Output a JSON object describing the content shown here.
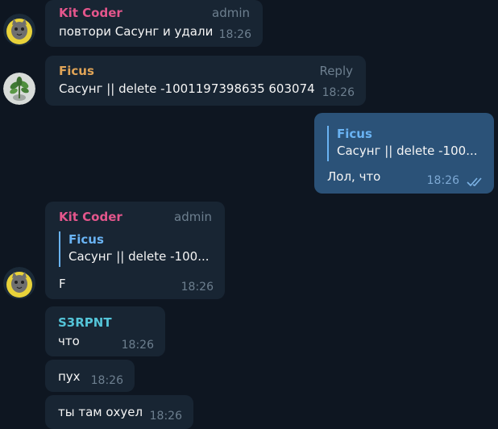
{
  "colors": {
    "background": "#0e1621",
    "incoming_bubble": "#182533",
    "outgoing_bubble": "#2b5278",
    "kit_coder_name": "#e4568c",
    "ficus_name": "#e0a457",
    "s3rpnt_name": "#54c4d8",
    "reply_accent": "#6ab3f3"
  },
  "messages": [
    {
      "sender": "Kit Coder",
      "role": "admin",
      "text": "повтори Сасунг и удали",
      "time": "18:26",
      "avatar": "kit-coder-avatar"
    },
    {
      "sender": "Ficus",
      "action": "Reply",
      "text": "Сасунг  || delete -1001197398635 603074",
      "time": "18:26",
      "avatar": "ficus-avatar"
    },
    {
      "outgoing": true,
      "reply_to": {
        "sender": "Ficus",
        "text": "Сасунг  || delete -100..."
      },
      "text": "Лол, что",
      "time": "18:26",
      "status_icon": "double-check-icon"
    },
    {
      "sender": "Kit Coder",
      "role": "admin",
      "reply_to": {
        "sender": "Ficus",
        "text": "Сасунг  || delete -100..."
      },
      "text": "F",
      "time": "18:26",
      "avatar": "kit-coder-avatar"
    },
    {
      "sender": "S3RPNT",
      "text": "что",
      "time": "18:26"
    },
    {
      "text": "пух",
      "time": "18:26"
    },
    {
      "text": "ты там охуел",
      "time": "18:26"
    }
  ]
}
